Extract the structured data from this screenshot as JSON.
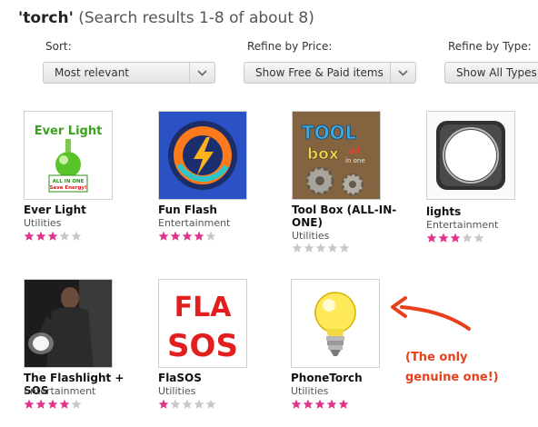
{
  "header": {
    "query": "'torch'",
    "results_text": "(Search results 1-8 of about 8)"
  },
  "filters": {
    "sort": {
      "label": "Sort:",
      "value": "Most relevant"
    },
    "price": {
      "label": "Refine by Price:",
      "value": "Show Free & Paid items"
    },
    "type": {
      "label": "Refine by Type:",
      "value": "Show All Types"
    }
  },
  "colors": {
    "star_on": "#e0338a",
    "star_off": "#c8c8c8",
    "annotation": "#e8401c"
  },
  "apps": [
    {
      "name": "Ever Light",
      "category": "Utilities",
      "rating": 3,
      "icon": "bulb-ever-light-icon",
      "logo_text": "Ever Light",
      "badge": [
        "ALL IN ONE",
        "Save Energy!"
      ]
    },
    {
      "name": "Fun Flash",
      "category": "Entertainment",
      "rating": 4,
      "icon": "flash-lightning-icon"
    },
    {
      "name": "Tool Box (ALL-IN-ONE)",
      "category": "Utilities",
      "rating": 0,
      "icon": "toolbox-gears-icon",
      "logo_text": [
        "TOOL",
        "box",
        "all",
        "in one"
      ]
    },
    {
      "name": "lights",
      "category": "Entertainment",
      "rating": 3,
      "icon": "light-square-icon"
    },
    {
      "name": "The Flashlight + SOS",
      "category": "Entertainment",
      "rating": 4,
      "icon": "man-with-flashlight-icon"
    },
    {
      "name": "FlaSOS",
      "category": "Utilities",
      "rating": 1,
      "icon": "flasos-logo-icon",
      "logo_text": [
        "FLA",
        "SOS"
      ]
    },
    {
      "name": "PhoneTorch",
      "category": "Utilities",
      "rating": 5,
      "icon": "yellow-lightbulb-icon"
    }
  ],
  "annotation": {
    "line1": "(The only",
    "line2": "genuine one!)"
  }
}
